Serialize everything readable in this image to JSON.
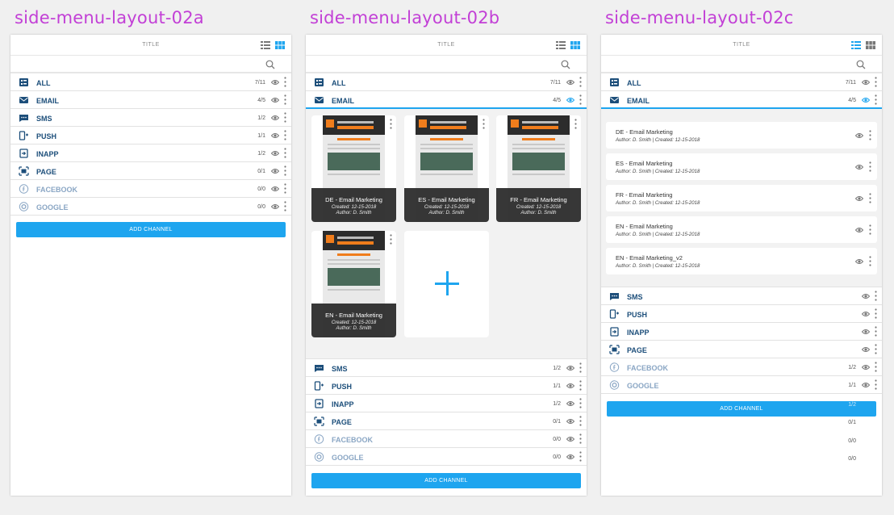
{
  "layouts": [
    {
      "heading": "side-menu-layout-02a"
    },
    {
      "heading": "side-menu-layout-02b"
    },
    {
      "heading": "side-menu-layout-02c"
    }
  ],
  "topbar_title": "TITLE",
  "add_channel_label": "ADD CHANNEL",
  "colors": {
    "accent": "#1ea5ef",
    "heading": "#c23fd6",
    "label": "#1c4e7a",
    "disabled_label": "#8aa6c4"
  },
  "channels_a": [
    {
      "label": "ALL",
      "count": "7/11",
      "icon": "all-icon"
    },
    {
      "label": "EMAIL",
      "count": "4/5",
      "icon": "email-icon"
    },
    {
      "label": "SMS",
      "count": "1/2",
      "icon": "sms-icon"
    },
    {
      "label": "PUSH",
      "count": "1/1",
      "icon": "push-icon"
    },
    {
      "label": "INAPP",
      "count": "1/2",
      "icon": "inapp-icon"
    },
    {
      "label": "PAGE",
      "count": "0/1",
      "icon": "page-icon"
    },
    {
      "label": "FACEBOOK",
      "count": "0/0",
      "icon": "facebook-icon"
    },
    {
      "label": "GOOGLE",
      "count": "0/0",
      "icon": "google-icon"
    }
  ],
  "cards": [
    {
      "name": "DE - Email Marketing",
      "created": "Created: 12-15-2018",
      "author": "Author: D. Smith"
    },
    {
      "name": "ES - Email Marketing",
      "created": "Created: 12-15-2018",
      "author": "Author: D. Smith"
    },
    {
      "name": "FR - Email Marketing",
      "created": "Created: 12-15-2018",
      "author": "Author: D. Smith"
    },
    {
      "name": "EN - Email Marketing",
      "created": "Created: 12-15-2018",
      "author": "Author: D. Smith"
    }
  ],
  "entries": [
    {
      "name": "DE - Email Marketing",
      "meta": "Author: D. Smith | Created: 12-15-2018"
    },
    {
      "name": "ES - Email Marketing",
      "meta": "Author: D. Smith | Created: 12-15-2018"
    },
    {
      "name": "FR - Email Marketing",
      "meta": "Author: D. Smith | Created: 12-15-2018"
    },
    {
      "name": "EN - Email Marketing",
      "meta": "Author: D. Smith | Created: 12-15-2018"
    },
    {
      "name": "EN - Email Marketing_v2",
      "meta": "Author: D. Smith | Created: 12-15-2018"
    }
  ],
  "channels_c_bottom": [
    {
      "label": "SMS",
      "count": ""
    },
    {
      "label": "PUSH",
      "count": ""
    },
    {
      "label": "INAPP",
      "count": ""
    },
    {
      "label": "PAGE",
      "count": ""
    },
    {
      "label": "FACEBOOK",
      "count": "1/2"
    },
    {
      "label": "GOOGLE",
      "count": "1/1"
    }
  ],
  "ghost_counts": [
    "1/2",
    "0/1",
    "0/0",
    "0/0"
  ]
}
